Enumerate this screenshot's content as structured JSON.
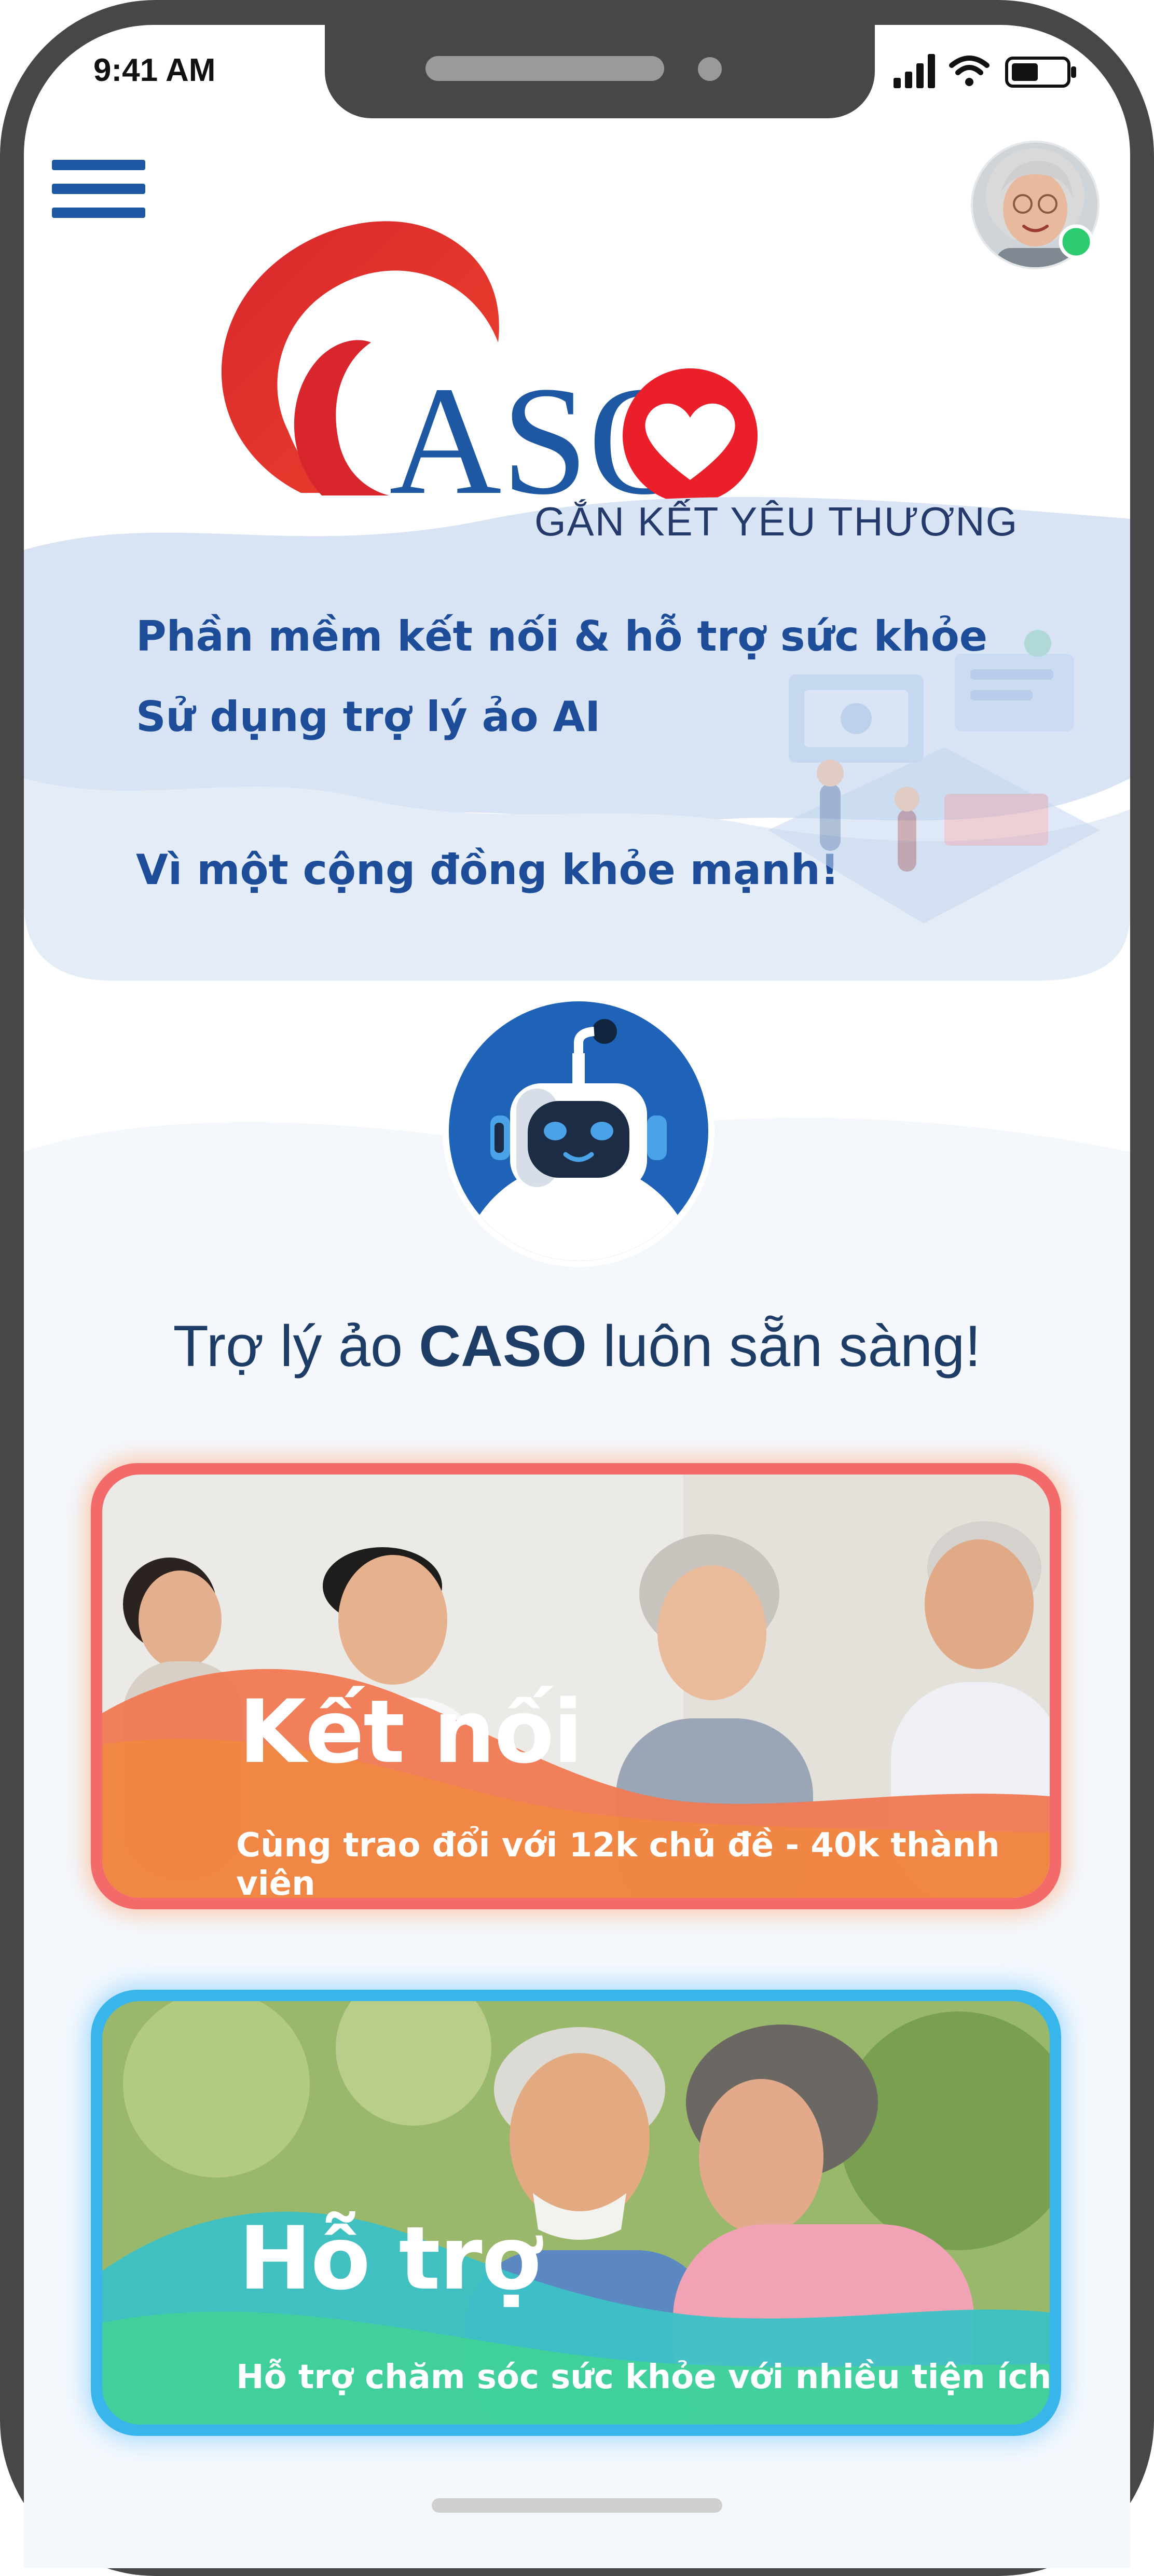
{
  "status_bar": {
    "time": "9:41 AM"
  },
  "brand": {
    "logo_text": "ASO",
    "tagline": "GẮN KẾT YÊU THƯƠNG"
  },
  "hero": {
    "line1": "Phần mềm kết nối & hỗ trợ sức khỏe",
    "line2": "Sử dụng trợ lý ảo AI",
    "line3": "Vì một cộng đồng khỏe mạnh!"
  },
  "assistant": {
    "title_prefix": "Trợ lý ảo ",
    "title_brand": "CASO",
    "title_suffix": " luôn sẵn sàng!"
  },
  "cards": [
    {
      "title": "Kết nối",
      "subtitle": "Cùng trao đổi với 12k chủ đề - 40k thành viên"
    },
    {
      "title": "Hỗ trợ",
      "subtitle": "Hỗ trợ chăm sóc sức khỏe với nhiều tiện ích"
    }
  ],
  "icons": {
    "menu": "hamburger-menu-icon",
    "avatar": "user-avatar",
    "online": "online-status-dot",
    "bot": "robot-assistant-icon"
  },
  "colors": {
    "primary": "#1d4c99",
    "logo_red": "#d8262c",
    "connect_card": "#f26b6a",
    "support_card": "#38b6ec",
    "online_dot": "#2ecc71"
  }
}
